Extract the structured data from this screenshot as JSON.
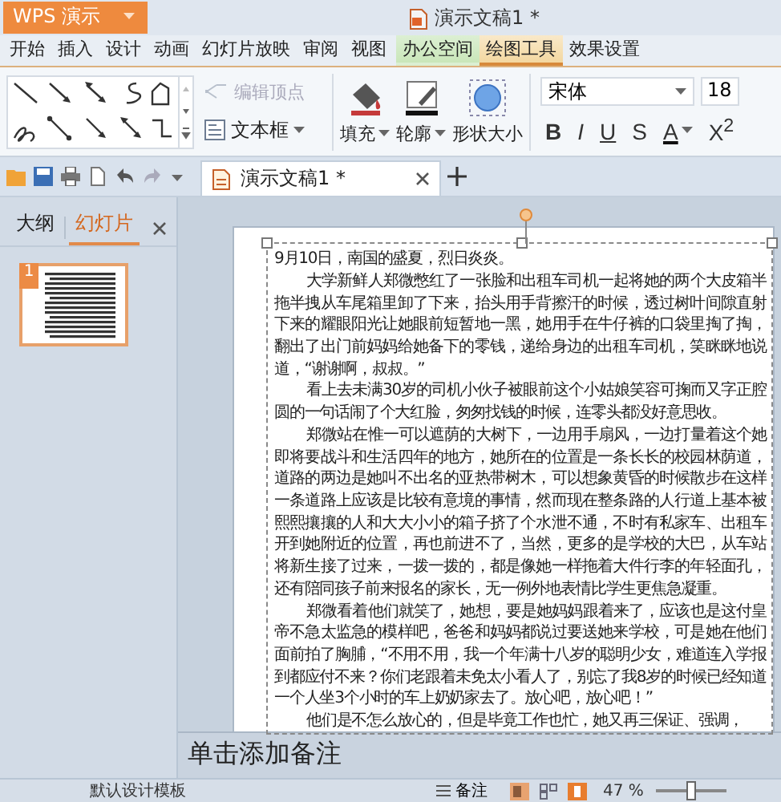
{
  "title_bar": {
    "app_button": "WPS 演示",
    "title": "演示文稿1 *"
  },
  "menu_tabs": [
    {
      "label": "开始",
      "kind": "plain",
      "selected": false
    },
    {
      "label": "插入",
      "kind": "plain",
      "selected": false
    },
    {
      "label": "设计",
      "kind": "plain",
      "selected": false
    },
    {
      "label": "动画",
      "kind": "plain",
      "selected": false
    },
    {
      "label": "幻灯片放映",
      "kind": "plain",
      "selected": false
    },
    {
      "label": "审阅",
      "kind": "plain",
      "selected": false
    },
    {
      "label": "视图",
      "kind": "plain",
      "selected": false
    },
    {
      "label": "办公空间",
      "kind": "office",
      "selected": false
    },
    {
      "label": "绘图工具",
      "kind": "tool",
      "selected": true
    },
    {
      "label": "效果设置",
      "kind": "tool",
      "selected": false
    }
  ],
  "ribbon": {
    "edit_points": {
      "label": "编辑顶点",
      "disabled": true
    },
    "text_box": "文本框",
    "fill": "填充",
    "outline": "轮廓",
    "shape_size": "形状大小",
    "font": {
      "value": "宋体"
    },
    "font_size": {
      "value": "18"
    },
    "format_buttons": [
      {
        "label": "B",
        "kind": "bold"
      },
      {
        "label": "I",
        "kind": "italic"
      },
      {
        "label": "U",
        "kind": "underline"
      },
      {
        "label": "S",
        "kind": "strike"
      },
      {
        "label": "A",
        "kind": "color"
      },
      {
        "label": "X$^{2}$",
        "kind": "super"
      }
    ]
  },
  "doc_tabs": [
    {
      "label": "演示文稿1 *",
      "selected": true
    }
  ],
  "side_panel": {
    "tabs": [
      {
        "label": "大纲",
        "selected": false
      },
      {
        "label": "幻灯片",
        "selected": true
      }
    ],
    "slides": [
      {
        "number": "1",
        "selected": true
      }
    ]
  },
  "slide": {
    "paragraphs": [
      {
        "kind": "date",
        "text": "9月10日，南国的盛夏，烈日炎炎。"
      },
      {
        "kind": "body",
        "text": "大学新鲜人郑微憋红了一张脸和出租车司机一起将她的两个大皮箱半拖半拽从车尾箱里卸了下来，抬头用手背擦汗的时候，透过树叶间隙直射下来的耀眼阳光让她眼前短暂地一黑，她用手在牛仔裤的口袋里掏了掏，翻出了出门前妈妈给她备下的零钱，递给身边的出租车司机，笑眯眯地说道，“谢谢啊，叔叔。”"
      },
      {
        "kind": "body",
        "text": "看上去未满30岁的司机小伙子被眼前这个小姑娘笑容可掬而又字正腔圆的一句话闹了个大红脸，匆匆找钱的时候，连零头都没好意思收。"
      },
      {
        "kind": "body",
        "text": "郑微站在惟一可以遮荫的大树下，一边用手扇风，一边打量着这个她即将要战斗和生活四年的地方，她所在的位置是一条长长的校园林荫道，道路的两边是她叫不出名的亚热带树木，可以想象黄昏的时候散步在这样一条道路上应该是比较有意境的事情，然而现在整条路的人行道上基本被熙熙攘攘的人和大大小小的箱子挤了个水泄不通，不时有私家车、出租车开到她附近的位置，再也前进不了，当然，更多的是学校的大巴，从车站将新生接了过来，一拨一拨的，都是像她一样拖着大件行李的年轻面孔，还有陪同孩子前来报名的家长，无一例外地表情比学生更焦急凝重。"
      },
      {
        "kind": "body",
        "text": "郑微看着他们就笑了，她想，要是她妈妈跟着来了，应该也是这付皇帝不急太监急的模样吧，爸爸和妈妈都说过要送她来学校，可是她在他们面前拍了胸脯，“不用不用，我一个年满十八岁的聪明少女，难道连入学报到都应付不来？你们老跟着未免太小看人了，别忘了我8岁的时候已经知道一个人坐3个小时的车上奶奶家去了。放心吧，放心吧！”"
      },
      {
        "kind": "body",
        "text": "他们是不怎么放心的，但是毕竟工作也忙，她又再三保证、强调，"
      }
    ]
  },
  "notes": {
    "placeholder": "单击添加备注"
  },
  "status_bar": {
    "template": "默认设计模板",
    "notes_button": "备注",
    "zoom": "47 %",
    "zoom_slider": {
      "level": 0.5
    }
  }
}
